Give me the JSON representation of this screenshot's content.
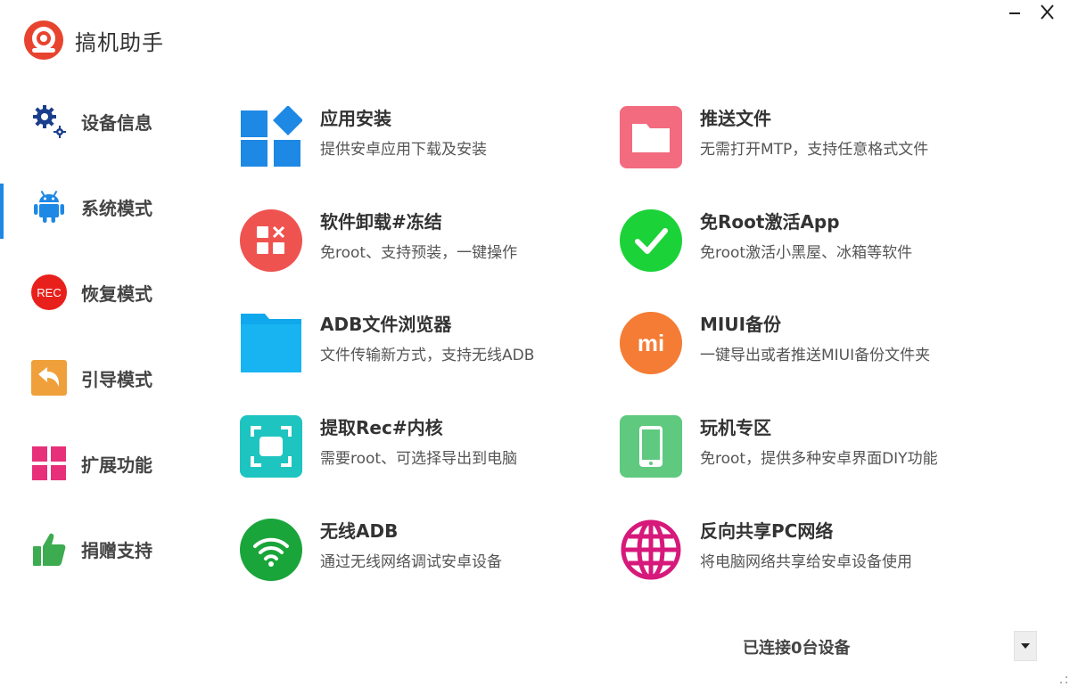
{
  "app": {
    "title": "搞机助手",
    "logo_icon": "camera-logo-icon",
    "accent": "#e8432e"
  },
  "window": {
    "minimize_glyph": "–",
    "close_glyph": "✕"
  },
  "sidebar": {
    "active_color": "#1e88e5",
    "items": [
      {
        "label": "设备信息",
        "icon": "gear-icon",
        "active": false
      },
      {
        "label": "系统模式",
        "icon": "android-icon",
        "active": true
      },
      {
        "label": "恢复模式",
        "icon": "rec-icon",
        "active": false,
        "icon_text": "REC"
      },
      {
        "label": "引导模式",
        "icon": "return-arrow-icon",
        "active": false
      },
      {
        "label": "扩展功能",
        "icon": "grid-icon",
        "active": false
      },
      {
        "label": "捐赠支持",
        "icon": "thumbs-up-icon",
        "active": false
      }
    ]
  },
  "features": [
    {
      "title": "应用安装",
      "desc": "提供安卓应用下载及安装",
      "icon": "app-install-icon",
      "color": "#1e88e5"
    },
    {
      "title": "推送文件",
      "desc": "无需打开MTP，支持任意格式文件",
      "icon": "folder-icon",
      "color": "#f26b7e"
    },
    {
      "title": "软件卸载#冻结",
      "desc": "免root、支持预装，一键操作",
      "icon": "uninstall-icon",
      "color": "#ef5350"
    },
    {
      "title": "免Root激活App",
      "desc": "免root激活小黑屋、冰箱等软件",
      "icon": "check-icon",
      "color": "#1bd338"
    },
    {
      "title": "ADB文件浏览器",
      "desc": "文件传输新方式，支持无线ADB",
      "icon": "file-browser-icon",
      "color": "#0fa8ec"
    },
    {
      "title": "MIUI备份",
      "desc": "一键导出或者推送MIUI备份文件夹",
      "icon": "mi-icon",
      "color": "#f47c35",
      "icon_text": "mi"
    },
    {
      "title": "提取Rec#内核",
      "desc": "需要root、可选择导出到电脑",
      "icon": "extract-icon",
      "color": "#1ec4c0"
    },
    {
      "title": "玩机专区",
      "desc": "免root，提供多种安卓界面DIY功能",
      "icon": "phone-icon",
      "color": "#5fc97f"
    },
    {
      "title": "无线ADB",
      "desc": "通过无线网络调试安卓设备",
      "icon": "wifi-icon",
      "color": "#1aa53a"
    },
    {
      "title": "反向共享PC网络",
      "desc": "将电脑网络共享给安卓设备使用",
      "icon": "globe-icon",
      "color": "#d6197a"
    }
  ],
  "status": {
    "text": "已连接0台设备",
    "dropdown_icon": "chevron-down-icon"
  }
}
